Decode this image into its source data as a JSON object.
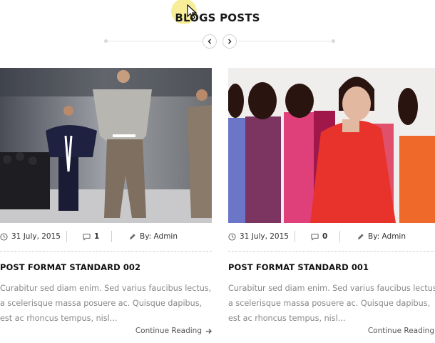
{
  "section": {
    "title": "BLOGS POSTS"
  },
  "nav": {
    "prev_icon": "chevron-left-icon",
    "next_icon": "chevron-right-icon"
  },
  "posts": [
    {
      "date": "31 July, 2015",
      "comments": "1",
      "author": "By: Admin",
      "title": "POST FORMAT STANDARD 002",
      "excerpt": "Curabitur sed diam enim. Sed varius faucibus lectus, a scelerisque massa posuere ac. Quisque dapibus, est ac rhoncus tempus, nisl...",
      "read_more": "Continue Reading"
    },
    {
      "date": "31 July, 2015",
      "comments": "0",
      "author": "By: Admin",
      "title": "POST FORMAT STANDARD 001",
      "excerpt": "Curabitur sed diam enim. Sed varius faucibus lectus, a scelerisque massa posuere ac. Quisque dapibus, est ac rhoncus tempus, nisl...",
      "read_more": "Continue Reading"
    }
  ],
  "colors": {
    "title": "#1a1a1a",
    "excerpt": "#888888",
    "divider": "#cfcfcf"
  }
}
